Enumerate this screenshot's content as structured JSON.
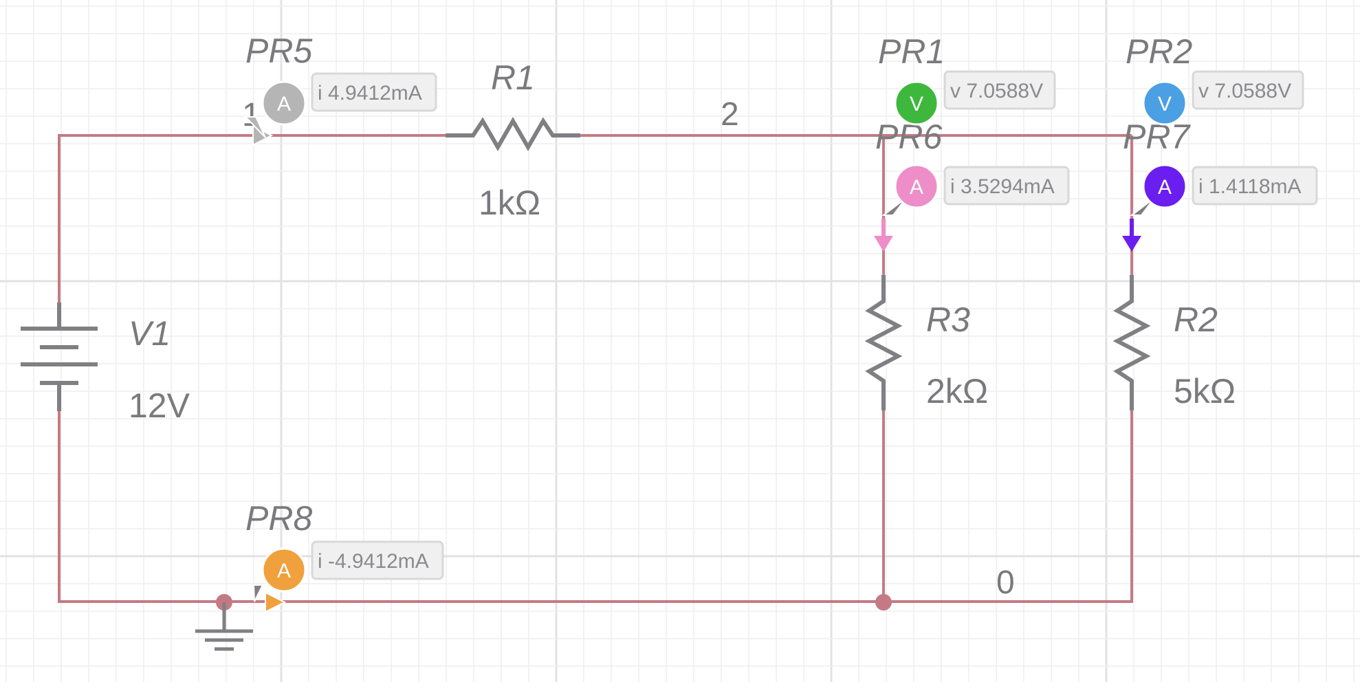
{
  "colors": {
    "wire": "#c47a84",
    "component": "#808084",
    "grid_minor": "#eeeeee",
    "grid_major": "#e2e2e2"
  },
  "nodes": {
    "n1": "1",
    "n2": "2",
    "n0": "0"
  },
  "components": {
    "v1": {
      "name": "V1",
      "value": "12V"
    },
    "r1": {
      "name": "R1",
      "value": "1kΩ"
    },
    "r3": {
      "name": "R3",
      "value": "2kΩ"
    },
    "r2": {
      "name": "R2",
      "value": "5kΩ"
    }
  },
  "probes": {
    "pr5": {
      "name": "PR5",
      "type_letter": "A",
      "reading": "i 4.9412mA",
      "color": "#b5b5b5"
    },
    "pr1": {
      "name": "PR1",
      "type_letter": "V",
      "reading": "v 7.0588V",
      "color": "#3db83d"
    },
    "pr2": {
      "name": "PR2",
      "type_letter": "V",
      "reading": "v 7.0588V",
      "color": "#4b9fe3"
    },
    "pr6": {
      "name": "PR6",
      "type_letter": "A",
      "reading": "i 3.5294mA",
      "color": "#ee8ec8"
    },
    "pr7": {
      "name": "PR7",
      "type_letter": "A",
      "reading": "i 1.4118mA",
      "color": "#6a1ef0"
    },
    "pr8": {
      "name": "PR8",
      "type_letter": "A",
      "reading": "i -4.9412mA",
      "color": "#f0a03c"
    }
  }
}
